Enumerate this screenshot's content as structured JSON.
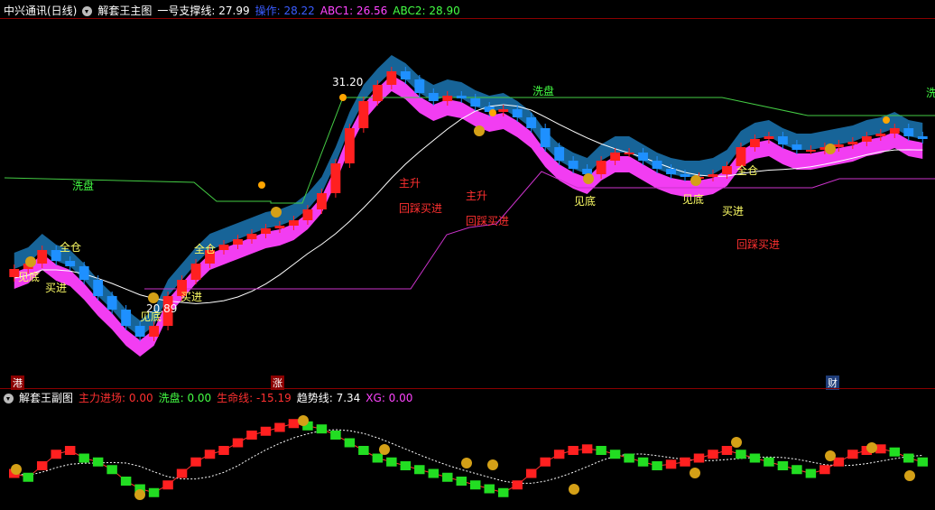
{
  "main_header": {
    "stock": "中兴通讯(日线)",
    "indicator": "解套王主图",
    "items": [
      {
        "label": "一号支撑线:",
        "value": "27.99",
        "color": "#ffffff"
      },
      {
        "label": "操作:",
        "value": "28.22",
        "color": "#3a5cff"
      },
      {
        "label": "ABC1:",
        "value": "26.56",
        "color": "#ff44ff"
      },
      {
        "label": "ABC2:",
        "value": "28.90",
        "color": "#44ff44"
      }
    ]
  },
  "sub_header": {
    "indicator": "解套王副图",
    "items": [
      {
        "label": "主力进场:",
        "value": "0.00",
        "color": "#ff3030"
      },
      {
        "label": "洗盘:",
        "value": "0.00",
        "color": "#44ff44"
      },
      {
        "label": "生命线:",
        "value": "-15.19",
        "color": "#ff3030"
      },
      {
        "label": "趋势线:",
        "value": "7.34",
        "color": "#ffffff"
      },
      {
        "label": "XG:",
        "value": "0.00",
        "color": "#ff44ff"
      }
    ]
  },
  "price_labels": {
    "high": "31.20",
    "low": "20.89"
  },
  "annotations": [
    {
      "text": "洗盘",
      "color": "#44ff44",
      "id": "xipan-1"
    },
    {
      "text": "洗盘",
      "color": "#44ff44",
      "id": "xipan-2"
    },
    {
      "text": "洗",
      "color": "#44ff44",
      "id": "xipan-3"
    },
    {
      "text": "全仓",
      "color": "#ffff66",
      "id": "quancang-1"
    },
    {
      "text": "全仓",
      "color": "#ffff66",
      "id": "quancang-2"
    },
    {
      "text": "全仓",
      "color": "#ffff66",
      "id": "quancang-3"
    },
    {
      "text": "见底",
      "color": "#ffff66",
      "id": "jiandi-1"
    },
    {
      "text": "见底",
      "color": "#ffff66",
      "id": "jiandi-2"
    },
    {
      "text": "见底",
      "color": "#ffff66",
      "id": "jiandi-3"
    },
    {
      "text": "见底",
      "color": "#ffff66",
      "id": "jiandi-4"
    },
    {
      "text": "买进",
      "color": "#ffff66",
      "id": "maijin-1"
    },
    {
      "text": "买进",
      "color": "#ffff66",
      "id": "maijin-2"
    },
    {
      "text": "买进",
      "color": "#ffff66",
      "id": "maijin-3"
    },
    {
      "text": "主升",
      "color": "#ff3030",
      "id": "zhusheng-1"
    },
    {
      "text": "主升",
      "color": "#ff3030",
      "id": "zhusheng-2"
    },
    {
      "text": "回踩买进",
      "color": "#ff3030",
      "id": "huicai-1"
    },
    {
      "text": "回踩买进",
      "color": "#ff3030",
      "id": "huicai-2"
    },
    {
      "text": "回踩买进",
      "color": "#ff3030",
      "id": "huicai-3"
    }
  ],
  "event_markers": [
    {
      "text": "港",
      "bg": "#8b0000",
      "color": "#ffffff"
    },
    {
      "text": "涨",
      "bg": "#8b0000",
      "color": "#ffffff"
    },
    {
      "text": "财",
      "bg": "#1e3c78",
      "color": "#ffffff"
    }
  ],
  "colors": {
    "up": "#ff2020",
    "down_candle": "#1e90ff",
    "pink": "#ff40ff",
    "blue_band": "#1a6fa8",
    "support": "#44cc44",
    "ma": "#ffffff"
  },
  "icons": [
    "money-bag-icon",
    "runner-icon",
    "collapse-arrow-icon"
  ]
}
